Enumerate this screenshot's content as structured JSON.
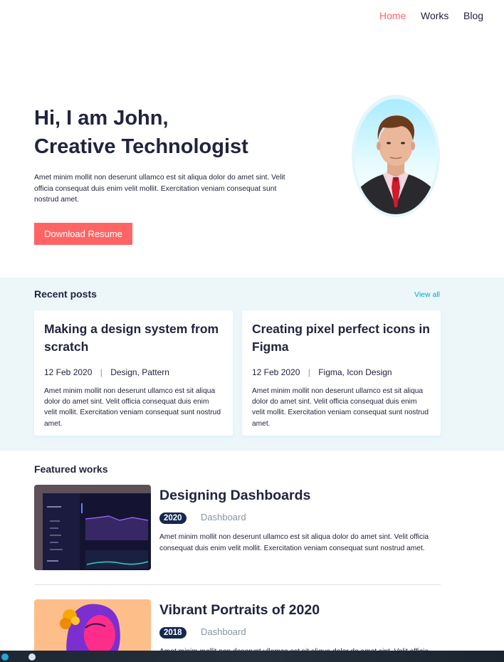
{
  "nav": {
    "items": [
      {
        "label": "Home",
        "active": true
      },
      {
        "label": "Works",
        "active": false
      },
      {
        "label": "Blog",
        "active": false
      }
    ]
  },
  "hero": {
    "title_line1": "Hi, I am John,",
    "title_line2": "Creative Technologist",
    "text": "Amet minim mollit non deserunt ullamco est sit aliqua dolor do amet sint. Velit officia consequat duis enim velit mollit. Exercitation veniam consequat sunt nostrud amet.",
    "button_label": "Download Resume"
  },
  "recent_posts": {
    "title": "Recent posts",
    "view_all": "View all",
    "posts": [
      {
        "title": "Making a design system from scratch",
        "date": "12 Feb 2020",
        "separator": "|",
        "tags": "Design, Pattern",
        "excerpt": "Amet minim mollit non deserunt ullamco est sit aliqua dolor do amet sint. Velit officia consequat duis enim velit mollit. Exercitation veniam consequat sunt nostrud amet."
      },
      {
        "title": "Creating pixel perfect icons in Figma",
        "date": "12 Feb 2020",
        "separator": "|",
        "tags": "Figma, Icon Design",
        "excerpt": "Amet minim mollit non deserunt ullamco est sit aliqua dolor do amet sint. Velit officia consequat duis enim velit mollit. Exercitation veniam consequat sunt nostrud amet."
      }
    ]
  },
  "featured_works": {
    "title": "Featured works",
    "works": [
      {
        "title": "Designing Dashboards",
        "year": "2020",
        "category": "Dashboard",
        "text": "Amet minim mollit non deserunt ullamco est sit aliqua dolor do amet sint. Velit officia consequat duis enim velit mollit. Exercitation veniam consequat sunt nostrud amet."
      },
      {
        "title": "Vibrant Portraits of 2020",
        "year": "2018",
        "category": "Dashboard",
        "text": "Amet minim mollit non deserunt ullamco est sit aliqua dolor do amet sint. Velit officia consequat duis enim velit mollit. Exercitation veniam consequat sunt nostrud amet."
      }
    ]
  },
  "colors": {
    "accent": "#FF6464",
    "dark": "#21243D",
    "light_bg": "#EDF7FA",
    "badge": "#142850",
    "muted": "#8695A4",
    "link": "#00A8CC"
  },
  "icons": {
    "avatar": "profile-photo",
    "thumb1": "dashboard-screenshot",
    "thumb2": "portrait-illustration"
  }
}
